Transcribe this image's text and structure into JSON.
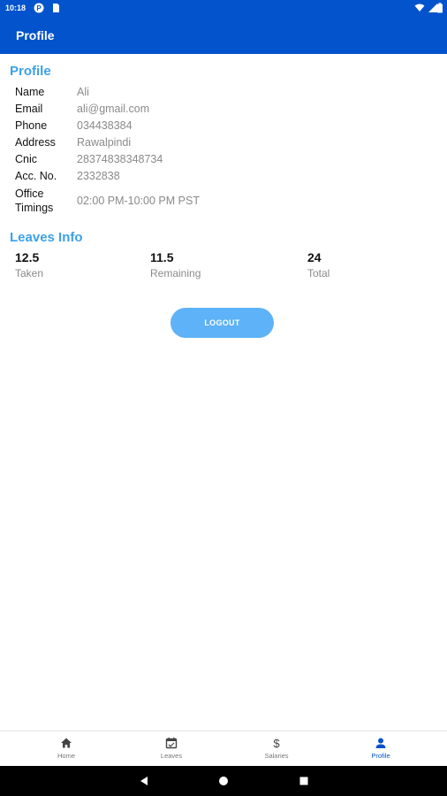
{
  "status_bar": {
    "time": "10:18"
  },
  "app_bar": {
    "title": "Profile"
  },
  "profile": {
    "section_title": "Profile",
    "fields": [
      {
        "label": "Name",
        "value": "Ali"
      },
      {
        "label": "Email",
        "value": "ali@gmail.com"
      },
      {
        "label": "Phone",
        "value": "034438384"
      },
      {
        "label": "Address",
        "value": "Rawalpindi"
      },
      {
        "label": "Cnic",
        "value": "28374838348734"
      },
      {
        "label": "Acc. No.",
        "value": "2332838"
      },
      {
        "label_line1": "Office",
        "label_line2": "Timings",
        "value": "02:00 PM-10:00 PM PST"
      }
    ]
  },
  "leaves_info": {
    "section_title": "Leaves Info",
    "taken": {
      "value": "12.5",
      "label": "Taken"
    },
    "remaining": {
      "value": "11.5",
      "label": "Remaining"
    },
    "total": {
      "value": "24",
      "label": "Total"
    }
  },
  "logout_button": {
    "label": "LOGOUT",
    "color": "#5eb2f7"
  },
  "bottom_nav": {
    "items": [
      {
        "label": "Home",
        "icon": "home-icon"
      },
      {
        "label": "Leaves",
        "icon": "calendar-icon"
      },
      {
        "label": "Salaries",
        "icon": "dollar-icon"
      },
      {
        "label": "Profile",
        "icon": "person-icon",
        "active": true
      }
    ]
  },
  "colors": {
    "primary": "#0353cc",
    "accent": "#3ba0ea"
  }
}
